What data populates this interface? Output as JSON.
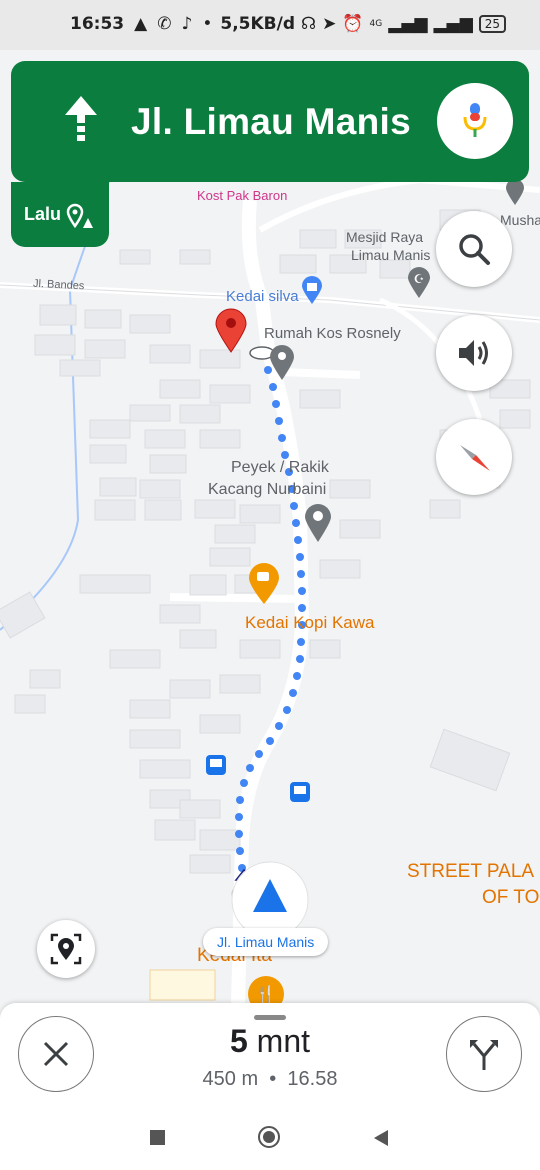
{
  "status_bar": {
    "time": "16:53",
    "network_speed": "5,5KB/d",
    "battery": "25",
    "net_type": "4G"
  },
  "navigation": {
    "street": "Jl. Limau Manis",
    "then_label": "Lalu"
  },
  "map": {
    "labels": {
      "kost_pak_baron": "Kost Pak Baron",
      "musha": "Musha",
      "mesjid_line1": "Mesjid Raya",
      "mesjid_line2": "Limau Manis",
      "jl_bandes": "Jl. Bandes",
      "kedai_silva": "Kedai silva",
      "rumah_kos": "Rumah Kos Rosnely",
      "peyek_line1": "Peyek / Rakik",
      "peyek_line2": "Kacang Nurbaini",
      "kedai_kopi": "Kedai Kopi Kawa",
      "street_pala_line1": "STREET PALA",
      "street_pala_line2": "OF TO",
      "kedai_ita": "Kedai Ita"
    },
    "current_road": "Jl. Limau Manis"
  },
  "trip": {
    "duration_value": "5",
    "duration_unit": "mnt",
    "distance": "450 m",
    "separator": "•",
    "arrival": "16.58"
  },
  "colors": {
    "nav_green": "#0b7d3e",
    "route_blue": "#4285f4",
    "pin_red": "#ea4335",
    "poi_orange": "#f29900"
  }
}
